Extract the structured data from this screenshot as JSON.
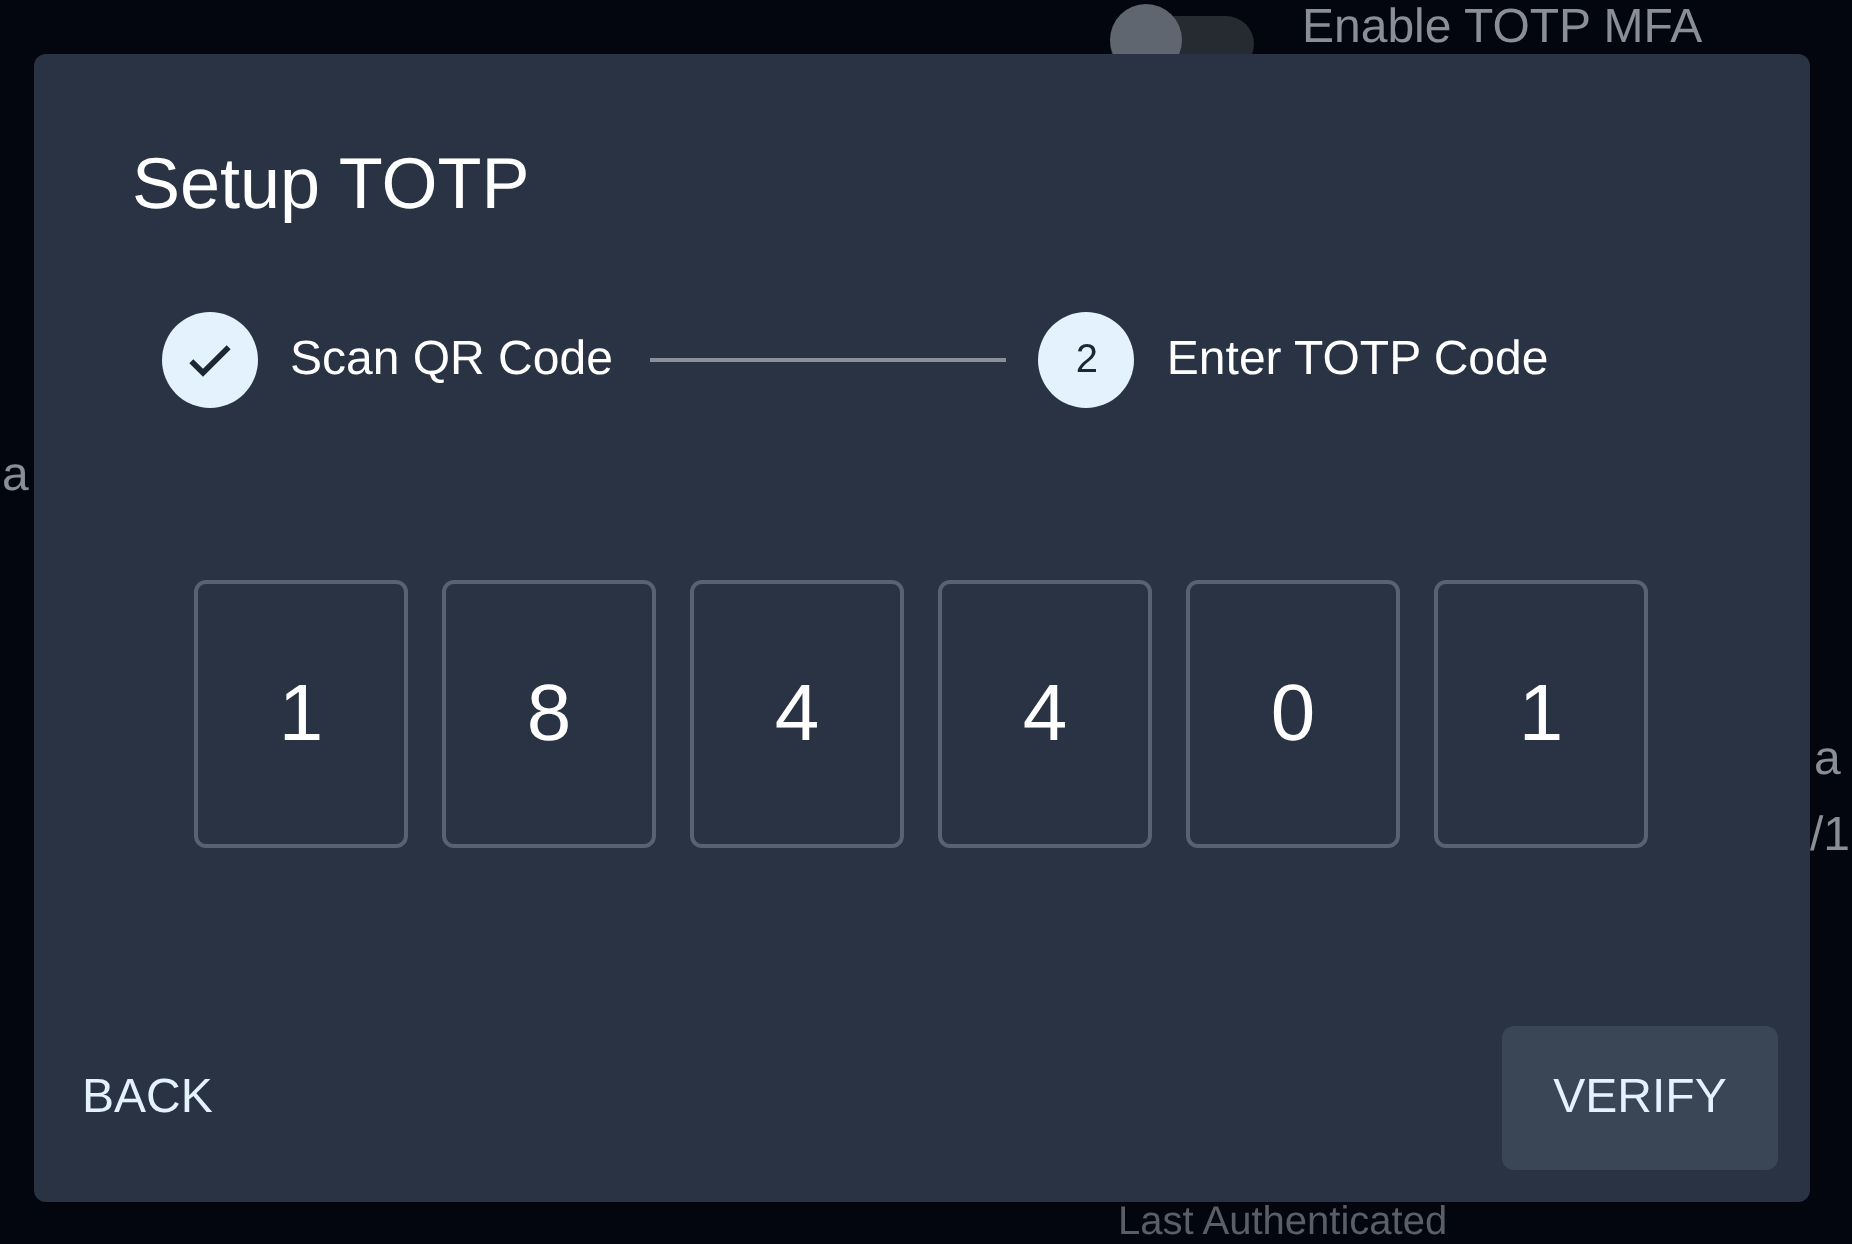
{
  "background": {
    "toggle": {
      "label": "Enable TOTP MFA",
      "on": false
    },
    "fragments": [
      "a",
      "a",
      "/1"
    ],
    "footer_label": "Last Authenticated"
  },
  "dialog": {
    "title": "Setup TOTP",
    "steps": [
      {
        "label": "Scan QR Code",
        "completed": true
      },
      {
        "label": "Enter TOTP Code",
        "completed": false,
        "number": "2"
      }
    ],
    "code_digits": [
      "1",
      "8",
      "4",
      "4",
      "0",
      "1"
    ],
    "back_button": "BACK",
    "verify_button": "VERIFY"
  }
}
